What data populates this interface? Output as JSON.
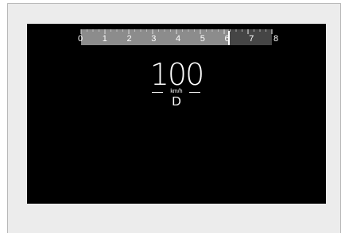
{
  "display": {
    "speed": "100",
    "unit": "km/h",
    "gear": "D"
  },
  "tachometer": {
    "scale_labels": [
      "0",
      "1",
      "2",
      "3",
      "4",
      "5",
      "6",
      "7",
      "8"
    ],
    "current_value": 6.2,
    "max_value": 8,
    "colors": {
      "filled": "#8c8c8c",
      "unfilled": "#454545",
      "tick": "#d0d0d0",
      "needle": "#ffffff"
    }
  }
}
